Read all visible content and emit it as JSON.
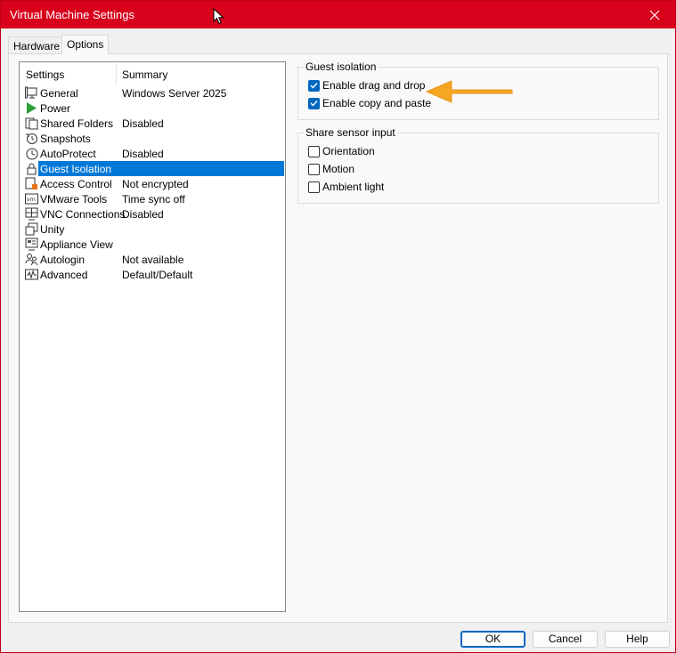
{
  "window": {
    "title": "Virtual Machine Settings"
  },
  "tabs": [
    {
      "label": "Hardware",
      "active": false
    },
    {
      "label": "Options",
      "active": true
    }
  ],
  "list": {
    "col_settings": "Settings",
    "col_summary": "Summary",
    "items": [
      {
        "name": "General",
        "summary": "Windows Server 2025",
        "icon": "monitor-icon"
      },
      {
        "name": "Power",
        "summary": "",
        "icon": "power-play-icon"
      },
      {
        "name": "Shared Folders",
        "summary": "Disabled",
        "icon": "shared-folders-icon"
      },
      {
        "name": "Snapshots",
        "summary": "",
        "icon": "snapshots-icon"
      },
      {
        "name": "AutoProtect",
        "summary": "Disabled",
        "icon": "clock-icon"
      },
      {
        "name": "Guest Isolation",
        "summary": "",
        "icon": "lock-icon",
        "selected": true
      },
      {
        "name": "Access Control",
        "summary": "Not encrypted",
        "icon": "access-control-icon"
      },
      {
        "name": "VMware Tools",
        "summary": "Time sync off",
        "icon": "vmware-tools-icon"
      },
      {
        "name": "VNC Connections",
        "summary": "Disabled",
        "icon": "vnc-icon"
      },
      {
        "name": "Unity",
        "summary": "",
        "icon": "unity-icon"
      },
      {
        "name": "Appliance View",
        "summary": "",
        "icon": "appliance-view-icon"
      },
      {
        "name": "Autologin",
        "summary": "Not available",
        "icon": "users-icon"
      },
      {
        "name": "Advanced",
        "summary": "Default/Default",
        "icon": "waveform-icon"
      }
    ]
  },
  "guest_isolation": {
    "title": "Guest isolation",
    "drag_drop": {
      "label": "Enable drag and drop",
      "checked": true
    },
    "copy_paste": {
      "label": "Enable copy and paste",
      "checked": true
    }
  },
  "sensor": {
    "title": "Share sensor input",
    "orientation": {
      "label": "Orientation",
      "checked": false
    },
    "motion": {
      "label": "Motion",
      "checked": false
    },
    "ambient": {
      "label": "Ambient light",
      "checked": false
    }
  },
  "buttons": {
    "ok": "OK",
    "cancel": "Cancel",
    "help": "Help"
  },
  "colors": {
    "titlebar": "#d8011c",
    "selection": "#0078d7",
    "checkbox": "#0067c0",
    "arrow": "#f5a623"
  }
}
